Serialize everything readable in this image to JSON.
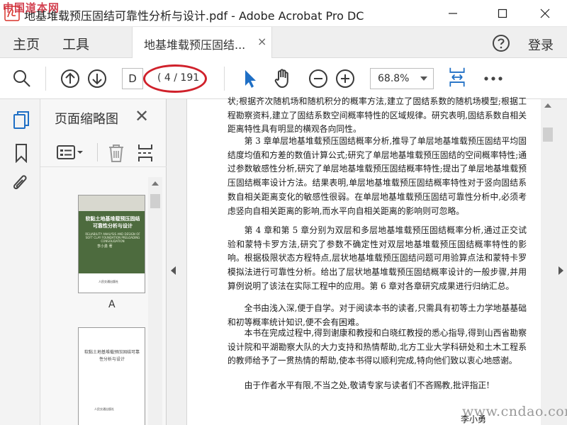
{
  "window": {
    "title": "地基堆载预压固结可靠性分析与设计.pdf - Adobe Acrobat Pro DC",
    "watermark_top": "中国道本网",
    "buttons": [
      "minimize-icon",
      "maximize-icon",
      "close-icon"
    ]
  },
  "tabs": {
    "home": "主页",
    "tools": "工具",
    "document": "地基堆载预压固结...",
    "document_close": "×",
    "login": "登录"
  },
  "toolbar": {
    "page_field": "D",
    "page_count": "( 4 / 191",
    "zoom": "68.8%",
    "icons": [
      "search-icon",
      "prev-page-icon",
      "next-page-icon",
      "select-cursor-icon",
      "hand-tool-icon",
      "zoom-out-icon",
      "zoom-in-icon",
      "fit-page-icon",
      "more-icon"
    ]
  },
  "highlight": {
    "color": "#d0212b"
  },
  "left_rail": {
    "icons": [
      "page-thumbnails-icon",
      "bookmark-icon",
      "attachment-icon"
    ]
  },
  "panel": {
    "title": "页面缩略图",
    "close": "✕",
    "tools": [
      "thumbnail-options-icon",
      "delete-page-icon",
      "extract-page-icon"
    ],
    "thumbnails": [
      {
        "label": "A",
        "cover_title": "软黏土地基堆载预压固结可靠性分析与设计",
        "cover_subtitle": "RELIABILITY ANALYSIS AND DESIGN OF SOFT CLAY FOUNDATION PRELOADING CONSOLIDATION",
        "cover_author": "李小勇  著",
        "cover_publisher": "人民交通出版社",
        "cover_color": "#4d6b3e"
      },
      {
        "label": "",
        "title": "软黏土地基堆载预压固结可靠性分析与设计",
        "publisher": "人民交通出版社"
      }
    ]
  },
  "document": {
    "paragraphs": [
      {
        "indent": false,
        "text": "状;根据齐次随机场和随机积分的概率方法,建立了固结系数的随机场模型;根据工程勘察资料,建立了固结系数空间概率特性的区域规律。研究表明,固结系数自相关距离特性具有明显的横观各向同性。"
      },
      {
        "indent": true,
        "text": "第 3 章单层地基堆载预压固结概率分析,推导了单层地基堆载预压固结平均固结度均值和方差的数值计算公式;研究了单层地基堆载预压固结的空间概率特性;通过参数敏感性分析,研究了单层地基堆载预压固结概率特性;提出了单层地基堆载预压固结概率设计方法。结果表明,单层地基堆载预压固结概率特性对于竖向固结系数自相关距离变化的敏感性很弱。在单层地基堆载预压固结可靠性分析中,必须考虑竖向自相关距离的影响,而水平向自相关距离的影响则可忽略。"
      },
      {
        "indent": true,
        "text": "第 4 章和第 5 章分别为双层和多层地基堆载预压固结概率分析,通过正交试验和蒙特卡罗方法,研究了参数不确定性对双层地基堆载预压固结概率特性的影响。根据极限状态方程特点,层状地基堆载预压固结问题可用验算点法和蒙特卡罗模拟法进行可靠性分析。给出了层状地基堆载预压固结概率设计的一般步骤,并用算例说明了该法在实际工程中的应用。第 6 章对各章研究成果进行归纳汇总。"
      },
      {
        "indent": true,
        "text": "全书由浅入深,便于自学。对于阅读本书的读者,只需具有初等土力学地基基础和初等概率统计知识,便不会有困难。"
      },
      {
        "indent": true,
        "text": "本书在完成过程中,得到谢康和教授和白晓红教授的悉心指导,得到山西省勘察设计院和平湖勘察大队的大力支持和热情帮助,北方工业大学科研处和土木工程系的教师给予了一贯热情的帮助,使本书得以顺利完成,特向他们致以衷心地感谢。"
      },
      {
        "indent": true,
        "text": "由于作者水平有限,不当之处,敬请专家与读者们不吝赐教,批评指正!"
      }
    ],
    "signature": "李小勇"
  },
  "watermark_bottom": "www.cndao.com"
}
